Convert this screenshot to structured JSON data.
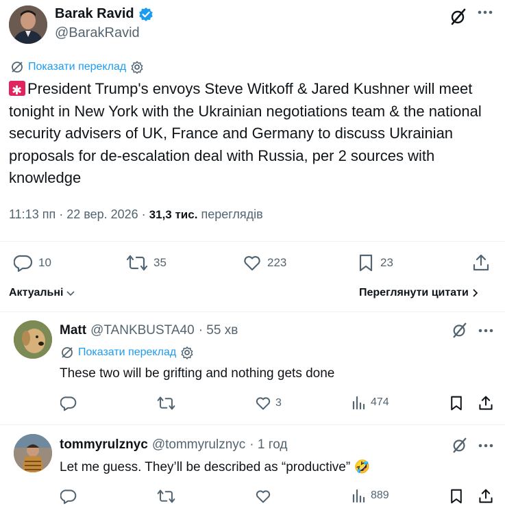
{
  "tweet": {
    "author_name": "Barak Ravid",
    "author_handle": "@BarakRavid",
    "translate_label": "Показати переклад",
    "text": "President Trump's envoys Steve Witkoff & Jared Kushner will meet tonight in New York with the Ukrainian negotiations team & the national security advisers of UK, France and Germany to discuss Ukrainian proposals for de-escalation deal with Russia, per 2 sources with knowledge",
    "time": "11:13 пп · 22 вер. 2026 ·",
    "views_count": "31,3 тис.",
    "views_label": "переглядів",
    "replies": "10",
    "reposts": "35",
    "likes": "223",
    "bookmarks": "23"
  },
  "sort": {
    "left_label": "Актуальні",
    "right_label": "Переглянути цитати"
  },
  "replies": [
    {
      "name": "Matt",
      "handle": "@TANKBUSTA40",
      "time": "· 55 хв",
      "translate_label": "Показати переклад",
      "text": "These two will be grifting and nothing gets done",
      "likes": "3",
      "views": "474"
    },
    {
      "name": "tommyrulznyc",
      "handle": "@tommyrulznyc",
      "time": "· 1 год",
      "text": "Let me guess. They’ll be described as “productive” 🤣",
      "views": "889"
    }
  ],
  "icons": {
    "verified_color": "#1d9bf0",
    "link_color": "#1d9bf0",
    "muted_color": "#536471",
    "text_color": "#0f1419",
    "siren_color": "#e0245e"
  }
}
